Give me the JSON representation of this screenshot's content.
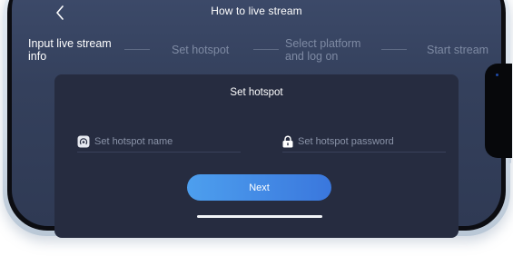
{
  "nav": {
    "title": "How to live stream"
  },
  "steps": [
    {
      "label_line1": "Input live stream",
      "label_line2": "info",
      "state": "active"
    },
    {
      "label_line1": "Set hotspot",
      "label_line2": "",
      "state": "inactive"
    },
    {
      "label_line1": "Select platform",
      "label_line2": "and log on",
      "state": "inactive"
    },
    {
      "label_line1": "Start stream",
      "label_line2": "",
      "state": "inactive"
    }
  ],
  "card": {
    "title": "Set hotspot",
    "hotspot_name": {
      "placeholder": "Set hotspot name",
      "value": ""
    },
    "hotspot_password": {
      "placeholder": "Set hotspot password",
      "value": ""
    },
    "next_label": "Next"
  },
  "icons": {
    "back": "chevron-left-icon",
    "hotspot_name": "hotspot-icon",
    "hotspot_password": "lock-icon"
  },
  "colors": {
    "accent_start": "#4d9fee",
    "accent_end": "#3a77dd",
    "screen_bg": "#36425f",
    "card_bg": "#262c40",
    "step_active": "#ffffff",
    "step_inactive": "#7e8aa3"
  }
}
